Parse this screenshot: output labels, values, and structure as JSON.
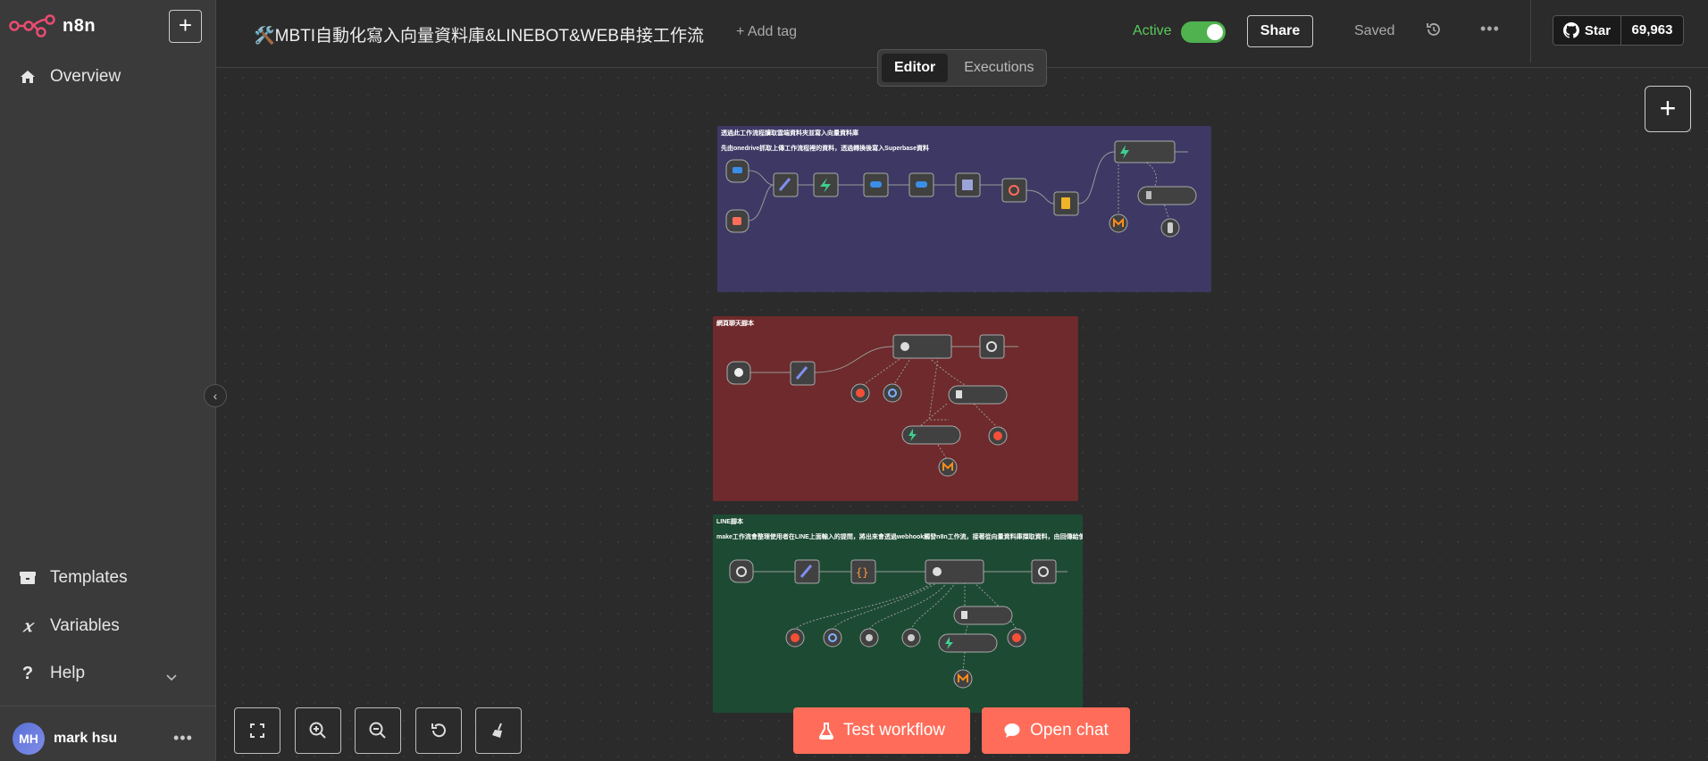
{
  "app": {
    "logo_text": "n8n"
  },
  "sidebar": {
    "items": [
      {
        "label": "Overview",
        "icon": "home-icon"
      },
      {
        "label": "Templates",
        "icon": "box-icon"
      },
      {
        "label": "Variables",
        "icon": "variable-icon"
      },
      {
        "label": "Help",
        "icon": "question-icon"
      }
    ],
    "user": {
      "initials": "MH",
      "name": "mark hsu"
    }
  },
  "header": {
    "title": "🛠️MBTI自動化寫入向量資料庫&LINEBOT&WEB串接工作流",
    "add_tag": "+ Add tag",
    "active_label": "Active",
    "active": true,
    "share_label": "Share",
    "saved_label": "Saved",
    "github": {
      "star_label": "Star",
      "count": "69,963"
    }
  },
  "tabs": [
    {
      "label": "Editor",
      "active": true
    },
    {
      "label": "Executions",
      "active": false
    }
  ],
  "canvas": {
    "notes": [
      {
        "title": "透過此工作流程讀取雲端資料夾並寫入向量資料庫",
        "subtitle": "先由onedrive抓取上傳工作流程裡的資料，透過轉換後寫入Superbase資料",
        "color": "#3d3964"
      },
      {
        "title": "網頁聊天腳本",
        "subtitle": "",
        "color": "#6e2a2c"
      },
      {
        "title": "LINE腳本",
        "subtitle": "make工作流會整理使用者在LINE上面輸入的提問，將出來會透過webhook觸發n8n工作流，接著從向量資料庫擷取資料，由回傳給使用者",
        "color": "#1d4a33"
      }
    ]
  },
  "bottom": {
    "test_label": "Test workflow",
    "chat_label": "Open chat"
  },
  "colors": {
    "accent": "#ff6d5a",
    "active": "#5ac95a"
  }
}
